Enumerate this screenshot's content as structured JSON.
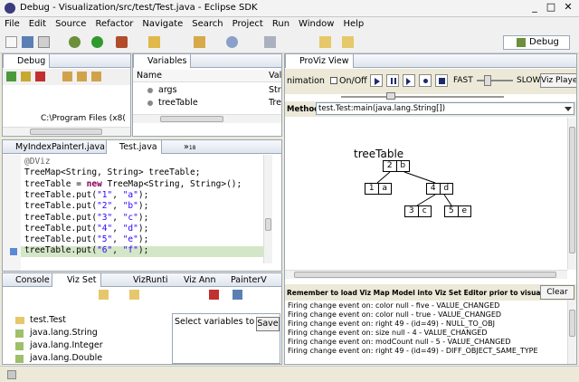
{
  "window": {
    "title": "Debug - Visualization/src/test/Test.java - Eclipse SDK",
    "minimize": "_",
    "maximize": "□",
    "close": "✕"
  },
  "menu": [
    "File",
    "Edit",
    "Source",
    "Refactor",
    "Navigate",
    "Search",
    "Project",
    "Run",
    "Window",
    "Help"
  ],
  "perspective": {
    "label": "Debug"
  },
  "debug_view": {
    "tab": "Debug",
    "path": "C:\\Program Files (x8("
  },
  "variables_view": {
    "tab": "Variables",
    "col_name": "Name",
    "col_value": "Valu",
    "rows": [
      {
        "name": "args",
        "value": "Stri"
      },
      {
        "name": "treeTable",
        "value": "Tree"
      }
    ]
  },
  "editor": {
    "tabs": [
      "MyIndexPainterI.java",
      "Test.java"
    ],
    "overflow": "»",
    "overflow_count": "18",
    "lines": [
      {
        "parts": [
          {
            "t": "@DViz",
            "c": "ann"
          }
        ]
      },
      {
        "parts": [
          {
            "t": "TreeMap<String, String> treeTable;",
            "c": ""
          }
        ]
      },
      {
        "parts": [
          {
            "t": "treeTable = ",
            "c": ""
          },
          {
            "t": "new",
            "c": "kw"
          },
          {
            "t": " TreeMap<String, String>();",
            "c": ""
          }
        ]
      },
      {
        "parts": [
          {
            "t": "treeTable.put(",
            "c": ""
          },
          {
            "t": "\"1\"",
            "c": "str"
          },
          {
            "t": ", ",
            "c": ""
          },
          {
            "t": "\"a\"",
            "c": "str"
          },
          {
            "t": ");",
            "c": ""
          }
        ]
      },
      {
        "parts": [
          {
            "t": "treeTable.put(",
            "c": ""
          },
          {
            "t": "\"2\"",
            "c": "str"
          },
          {
            "t": ", ",
            "c": ""
          },
          {
            "t": "\"b\"",
            "c": "str"
          },
          {
            "t": ");",
            "c": ""
          }
        ]
      },
      {
        "parts": [
          {
            "t": "treeTable.put(",
            "c": ""
          },
          {
            "t": "\"3\"",
            "c": "str"
          },
          {
            "t": ", ",
            "c": ""
          },
          {
            "t": "\"c\"",
            "c": "str"
          },
          {
            "t": ");",
            "c": ""
          }
        ]
      },
      {
        "parts": [
          {
            "t": "treeTable.put(",
            "c": ""
          },
          {
            "t": "\"4\"",
            "c": "str"
          },
          {
            "t": ", ",
            "c": ""
          },
          {
            "t": "\"d\"",
            "c": "str"
          },
          {
            "t": ");",
            "c": ""
          }
        ]
      },
      {
        "parts": [
          {
            "t": "treeTable.put(",
            "c": ""
          },
          {
            "t": "\"5\"",
            "c": "str"
          },
          {
            "t": ", ",
            "c": ""
          },
          {
            "t": "\"e\"",
            "c": "str"
          },
          {
            "t": ");",
            "c": ""
          }
        ]
      },
      {
        "parts": [
          {
            "t": "treeTable.put(",
            "c": ""
          },
          {
            "t": "\"6\"",
            "c": "str"
          },
          {
            "t": ", ",
            "c": ""
          },
          {
            "t": "\"f\"",
            "c": "str"
          },
          {
            "t": ");",
            "c": ""
          }
        ]
      }
    ]
  },
  "bottom_left": {
    "tabs": [
      "Console",
      "Viz Set",
      "VizRunti",
      "Viz Ann",
      "PainterV"
    ],
    "tree": [
      "test.Test",
      "java.lang.String",
      "java.lang.Integer",
      "java.lang.Double"
    ],
    "select_placeholder": "Select variables to list",
    "save": "Save"
  },
  "proviz": {
    "tab": "ProViz View",
    "animation_label": "nimation",
    "onoff": "On/Off",
    "fast": "FAST",
    "slow": "SLOW",
    "player": "Viz Player",
    "method_label": "Method:",
    "method_value": "test.Test:main(java.lang.String[])",
    "tree_title": "treeTable",
    "nodes": [
      {
        "k": "2",
        "v": "b"
      },
      {
        "k": "1",
        "v": "a"
      },
      {
        "k": "4",
        "v": "d"
      },
      {
        "k": "3",
        "v": "c"
      },
      {
        "k": "5",
        "v": "e"
      }
    ],
    "remember": "Remember to load Viz Map Model into Viz Set Editor prior to visualization",
    "clear": "Clear",
    "log": [
      "Firing change event on: color null - five - VALUE_CHANGED",
      "Firing change event on: color null - true - VALUE_CHANGED",
      "Firing change event on: right 49 - (id=49) - NULL_TO_OBJ",
      "Firing change event on: size null - 4 - VALUE_CHANGED",
      "Firing change event on: modCount null - 5 - VALUE_CHANGED",
      "Firing change event on: right 49 - (id=49) - DIFF_OBJECT_SAME_TYPE"
    ]
  },
  "colors": {
    "accent": "#0a246a",
    "current_line": "#d4e6c8",
    "panel_border": "#9aa7b8"
  }
}
